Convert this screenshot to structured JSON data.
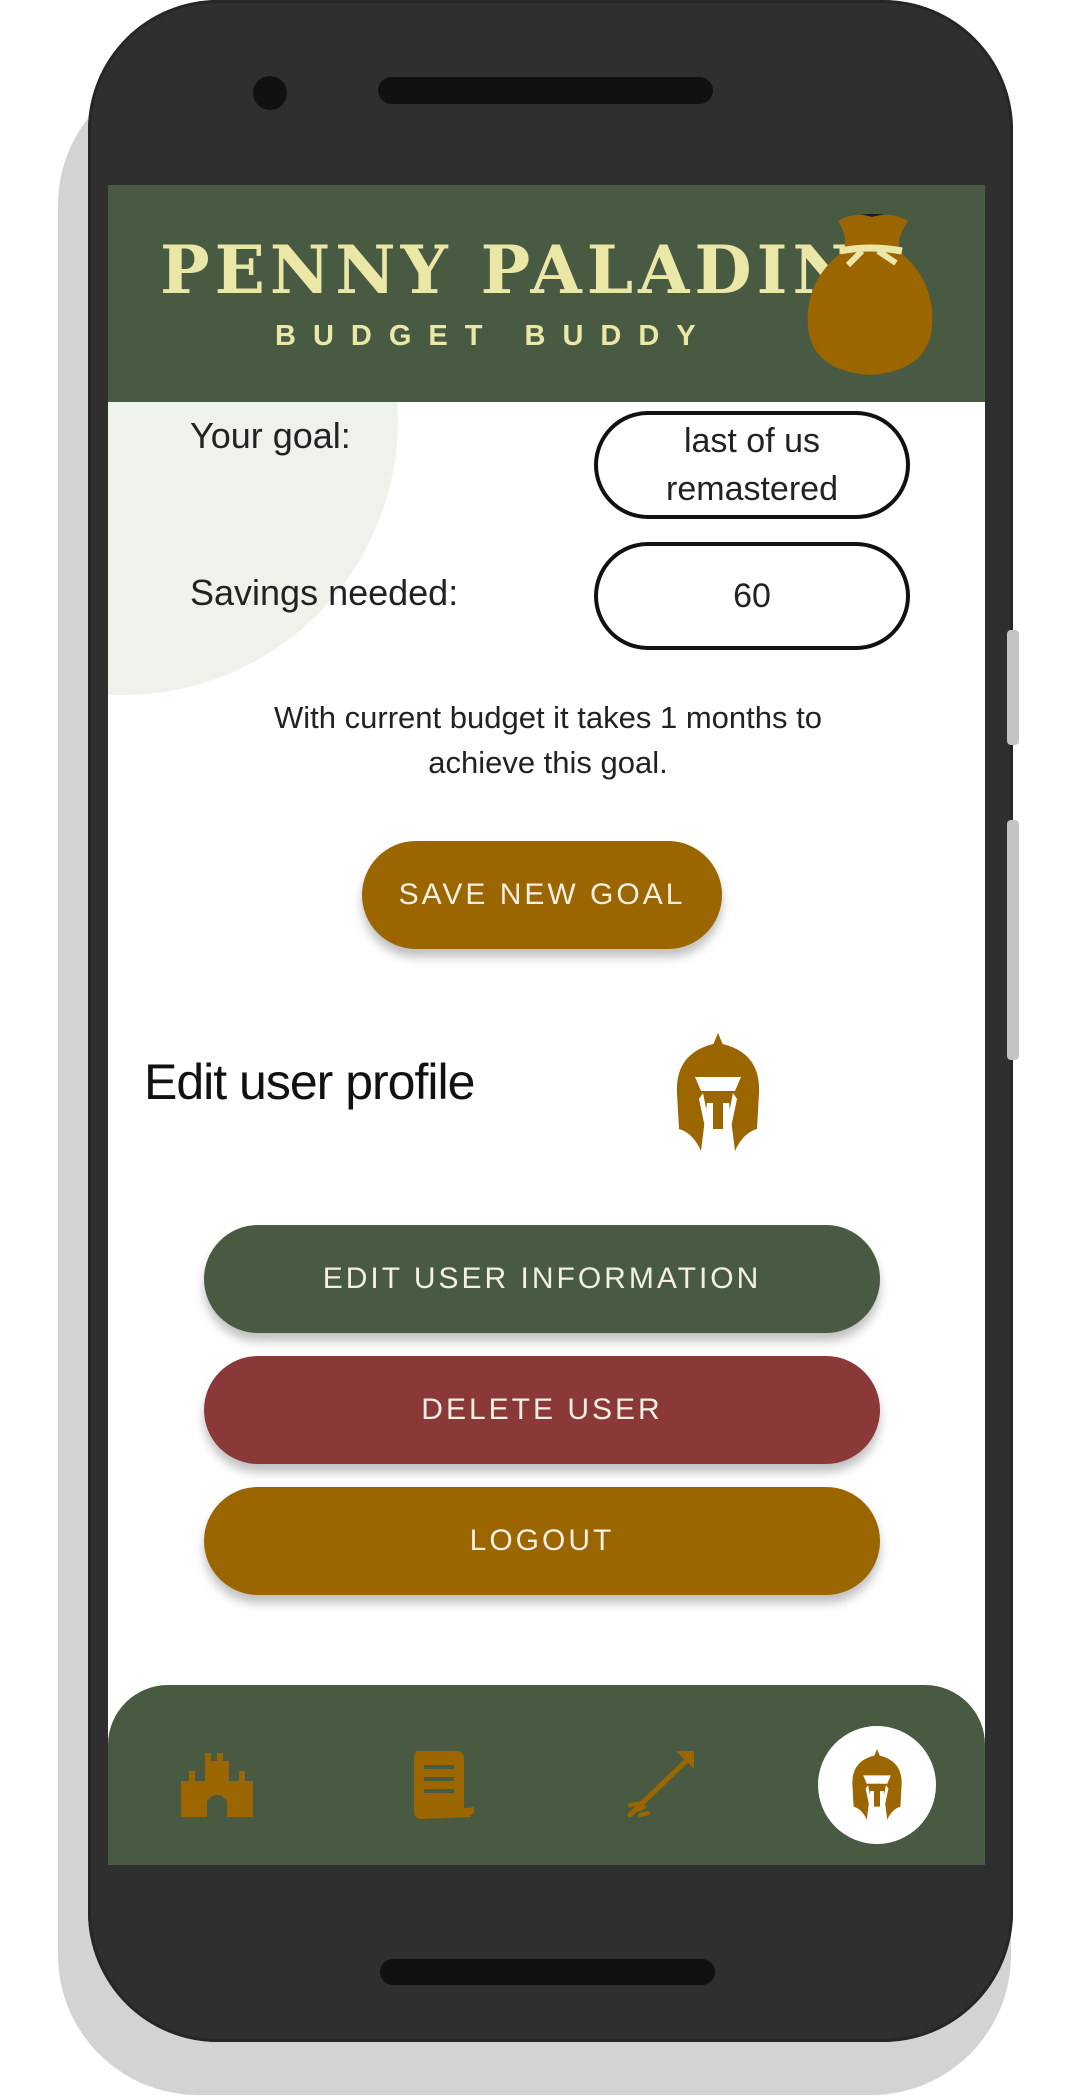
{
  "app": {
    "title": "PENNY PALADIN",
    "subtitle": "BUDGET BUDDY"
  },
  "goal": {
    "goal_label": "Your goal:",
    "goal_value": "last of us remastered",
    "savings_label": "Savings needed:",
    "savings_value": "60",
    "info_text": "With current budget it takes 1 months to achieve this goal.",
    "save_button": "SAVE NEW GOAL"
  },
  "profile": {
    "heading": "Edit user profile",
    "edit_button": "EDIT USER INFORMATION",
    "delete_button": "DELETE USER",
    "logout_button": "LOGOUT"
  },
  "nav": {
    "items": [
      {
        "icon": "castle-icon"
      },
      {
        "icon": "scroll-icon"
      },
      {
        "icon": "arrow-icon"
      },
      {
        "icon": "helmet-icon",
        "active": true
      }
    ]
  },
  "colors": {
    "brand_green": "#485a41",
    "brand_gold": "#9b6500",
    "danger_red": "#8b3838",
    "title_cream": "#ebe7a7"
  }
}
